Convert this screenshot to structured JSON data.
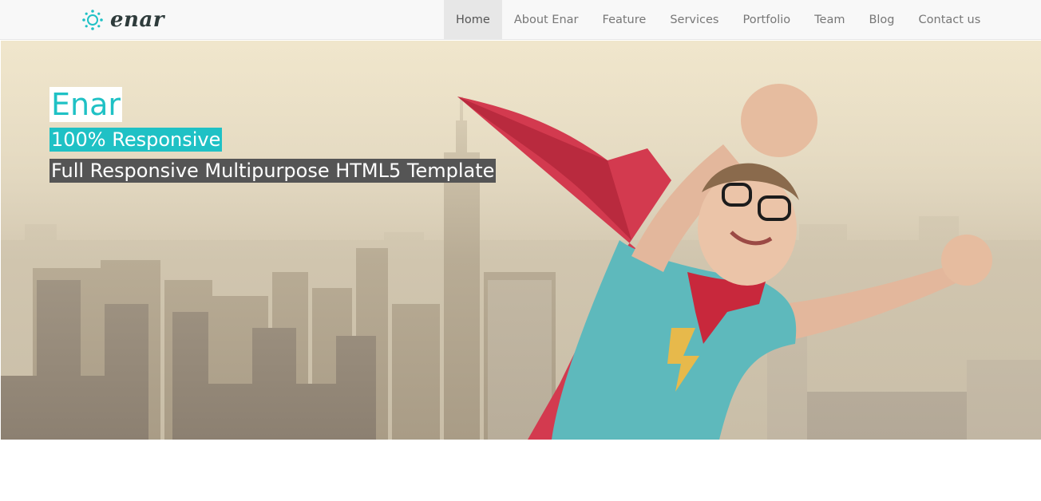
{
  "brand": {
    "name": "enar",
    "icon": "sun-dots-icon",
    "accent": "#1fc1c5"
  },
  "nav": {
    "items": [
      {
        "label": "Home",
        "active": true
      },
      {
        "label": "About Enar"
      },
      {
        "label": "Feature"
      },
      {
        "label": "Services"
      },
      {
        "label": "Portfolio"
      },
      {
        "label": "Team"
      },
      {
        "label": "Blog"
      },
      {
        "label": "Contact us"
      }
    ]
  },
  "hero": {
    "title": "Enar",
    "subtitle": "100% Responsive",
    "description": "Full Responsive Multipurpose HTML5 Template",
    "image": "superhero-kid-flying-over-city"
  }
}
